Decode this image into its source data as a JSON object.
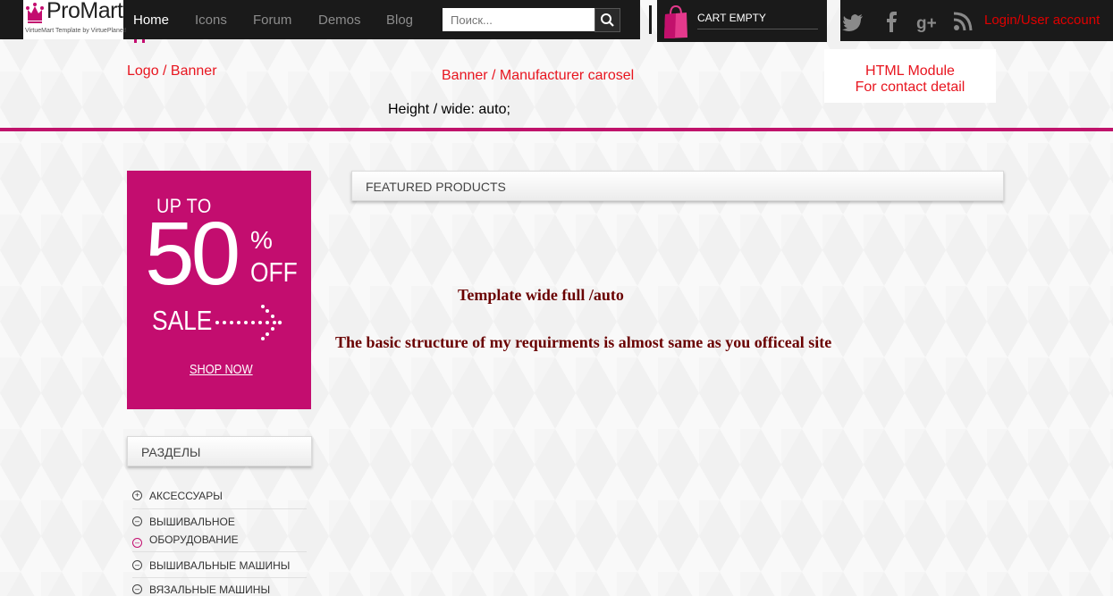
{
  "logo": {
    "name": "ProMart",
    "tagline": "VirtueMart Template by VirtuePlanet!"
  },
  "nav": {
    "items": [
      {
        "label": "Home",
        "active": true
      },
      {
        "label": "Icons",
        "active": false
      },
      {
        "label": "Forum",
        "active": false
      },
      {
        "label": "Demos",
        "active": false
      },
      {
        "label": "Blog",
        "active": false
      }
    ]
  },
  "search": {
    "placeholder": "Поиск...",
    "icon": "search-icon"
  },
  "cart": {
    "label": "CART EMPTY",
    "icon": "shopping-bag-icon"
  },
  "social": {
    "icons": [
      "twitter-icon",
      "facebook-icon",
      "google-plus-icon",
      "rss-icon"
    ]
  },
  "login": {
    "label": "Login/User account"
  },
  "annotations": {
    "logo_banner": "Logo / Banner",
    "banner_carousel": "Banner / Manufacturer carosel",
    "html_module_line1": "HTML Module",
    "html_module_line2": "For contact detail",
    "height_wide": "Height / wide: auto;",
    "template_wide": "Template wide full /auto",
    "structure_note": "The basic structure of my requirments is almost same as you officeal site"
  },
  "promo": {
    "up_to": "UP TO",
    "number": "50",
    "percent": "%",
    "off": "OFF",
    "sale": "SALE",
    "shop_now": "SHOP NOW"
  },
  "featured": {
    "title": "FEATURED PRODUCTS"
  },
  "sections": {
    "title": "РАЗДЕЛЫ",
    "items": [
      {
        "label": "АКСЕССУАРЫ",
        "icon": "expand-icon"
      },
      {
        "label": "ВЫШИВАЛЬНОЕ",
        "icon": "collapse-icon"
      },
      {
        "label": "ОБОРУДОВАНИЕ",
        "icon": "collapse-icon"
      },
      {
        "label": "ВЫШИВАЛЬНЫЕ МАШИНЫ",
        "icon": "collapse-icon"
      },
      {
        "label": "ВЯЗАЛЬНЫЕ МАШИНЫ",
        "icon": "collapse-icon"
      }
    ]
  },
  "colors": {
    "accent": "#c30d6f",
    "annotation_red": "#e8151f",
    "note_dark_red": "#6a0000",
    "bar": "#1a1a1a"
  }
}
